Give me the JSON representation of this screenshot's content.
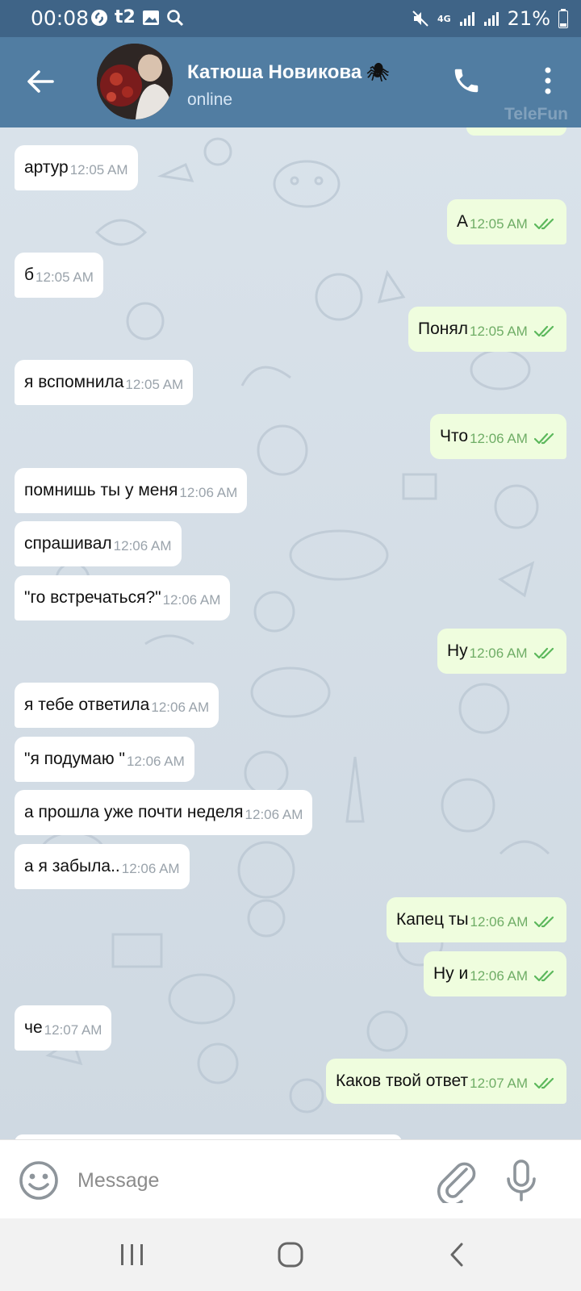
{
  "status_bar": {
    "time": "00:08",
    "carrier": "t2",
    "network": "4G",
    "battery": "21%"
  },
  "header": {
    "title": "Катюша Новикова",
    "title_emoji": "🕷",
    "status": "online",
    "watermark": "TeleFun"
  },
  "messages": [
    {
      "dir": "in",
      "text": "артур",
      "time": "12:05 AM"
    },
    {
      "dir": "out",
      "text": "А",
      "time": "12:05 AM"
    },
    {
      "dir": "in",
      "text": "б",
      "time": "12:05 AM"
    },
    {
      "dir": "out",
      "text": "Понял",
      "time": "12:05 AM"
    },
    {
      "dir": "in",
      "text": "я вспомнила",
      "time": "12:05 AM"
    },
    {
      "dir": "out",
      "text": "Что",
      "time": "12:06 AM"
    },
    {
      "dir": "in",
      "text": "помнишь ты у меня",
      "time": "12:06 AM"
    },
    {
      "dir": "in",
      "text": "спрашивал",
      "time": "12:06 AM"
    },
    {
      "dir": "in",
      "text": "\"го встречаться?\"",
      "time": "12:06 AM"
    },
    {
      "dir": "out",
      "text": "Ну",
      "time": "12:06 AM"
    },
    {
      "dir": "in",
      "text": "я тебе ответила",
      "time": "12:06 AM"
    },
    {
      "dir": "in",
      "text": "\"я подумаю \"",
      "time": "12:06 AM"
    },
    {
      "dir": "in",
      "text": "а прошла уже почти неделя",
      "time": "12:06 AM"
    },
    {
      "dir": "in",
      "text": "а я забыла..",
      "time": "12:06 AM"
    },
    {
      "dir": "out",
      "text": "Капец ты",
      "time": "12:06 AM"
    },
    {
      "dir": "out",
      "text": "Ну и",
      "time": "12:06 AM"
    },
    {
      "dir": "in",
      "text": "че",
      "time": "12:07 AM"
    },
    {
      "dir": "out",
      "text": "Каков твой ответ",
      "time": "12:07 AM"
    }
  ],
  "input": {
    "placeholder": "Message",
    "value": ""
  },
  "icons": {
    "back": "arrow-left-icon",
    "call": "phone-icon",
    "menu": "more-vertical-icon",
    "emoji": "smiley-icon",
    "attach": "paperclip-icon",
    "mic": "microphone-icon",
    "read": "double-check-icon"
  },
  "colors": {
    "header": "#517da2",
    "status_bar": "#3f6487",
    "incoming_bubble": "#ffffff",
    "outgoing_bubble": "#effdde",
    "check": "#5cb85c",
    "chat_bg": "#d7e0e8"
  }
}
